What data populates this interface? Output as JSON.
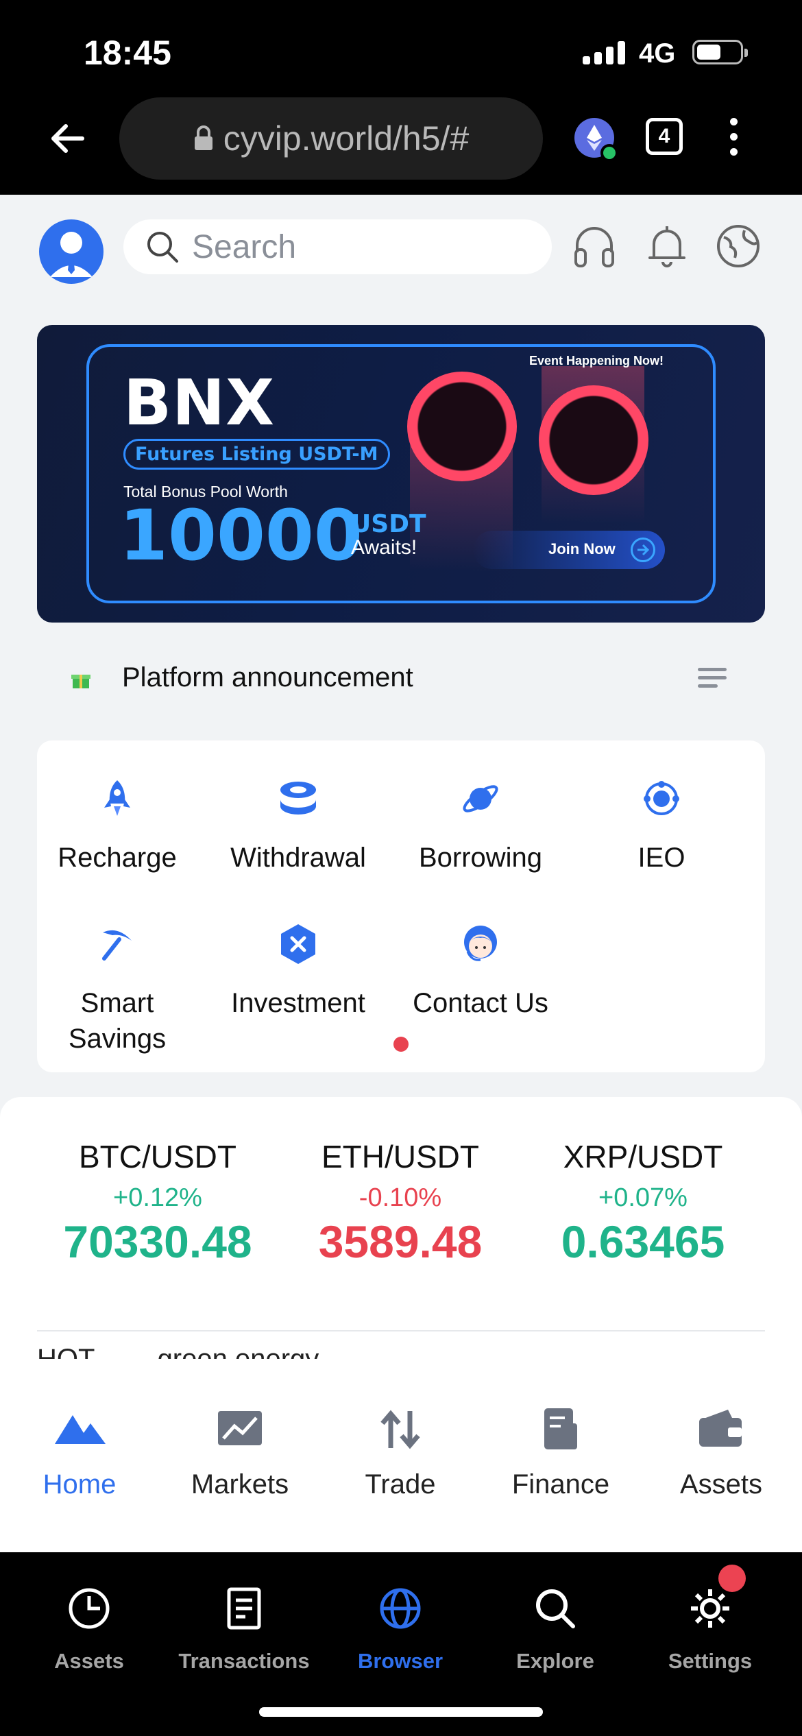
{
  "status_bar": {
    "time": "18:45",
    "network": "4G"
  },
  "browser": {
    "url": "cyvip.world/h5/#",
    "tab_count": "4"
  },
  "header": {
    "search_placeholder": "Search"
  },
  "banner": {
    "title": "BNX",
    "subtitle": "Futures Listing USDT-M",
    "pool_label": "Total Bonus Pool Worth",
    "amount": "10000",
    "currency": "USDT",
    "awaits": "Awaits!",
    "event_label": "Event Happening Now!",
    "cta": "Join Now"
  },
  "announcement": {
    "label": "Platform announcement"
  },
  "features": [
    {
      "label": "Recharge",
      "icon": "rocket-icon"
    },
    {
      "label": "Withdrawal",
      "icon": "coins-icon"
    },
    {
      "label": "Borrowing",
      "icon": "planet-icon"
    },
    {
      "label": "IEO",
      "icon": "orbit-icon"
    },
    {
      "label": "Smart Savings",
      "icon": "pickaxe-icon"
    },
    {
      "label": "Investment",
      "icon": "hexagon-x-icon"
    },
    {
      "label": "Contact Us",
      "icon": "support-agent-icon"
    }
  ],
  "tickers": [
    {
      "pair": "BTC/USDT",
      "change": "+0.12%",
      "price": "70330.48",
      "trend": "up"
    },
    {
      "pair": "ETH/USDT",
      "change": "-0.10%",
      "price": "3589.48",
      "trend": "down"
    },
    {
      "pair": "XRP/USDT",
      "change": "+0.07%",
      "price": "0.63465",
      "trend": "up"
    }
  ],
  "hot_row": [
    "HOT",
    "green energy"
  ],
  "app_tabs": [
    {
      "label": "Home",
      "icon": "home-mountain-icon",
      "active": true
    },
    {
      "label": "Markets",
      "icon": "chart-icon",
      "active": false
    },
    {
      "label": "Trade",
      "icon": "swap-arrows-icon",
      "active": false
    },
    {
      "label": "Finance",
      "icon": "document-icon",
      "active": false
    },
    {
      "label": "Assets",
      "icon": "wallet-icon",
      "active": false
    }
  ],
  "browser_nav": [
    {
      "label": "Assets",
      "icon": "pie-chart-icon",
      "active": false
    },
    {
      "label": "Transactions",
      "icon": "receipt-icon",
      "active": false
    },
    {
      "label": "Browser",
      "icon": "globe-icon",
      "active": true
    },
    {
      "label": "Explore",
      "icon": "search-icon",
      "active": false
    },
    {
      "label": "Settings",
      "icon": "gear-icon",
      "active": false
    }
  ],
  "colors": {
    "accent": "#2f6fed",
    "up": "#1fb38a",
    "down": "#e8424f",
    "banner_blue": "#3aa6ff"
  }
}
